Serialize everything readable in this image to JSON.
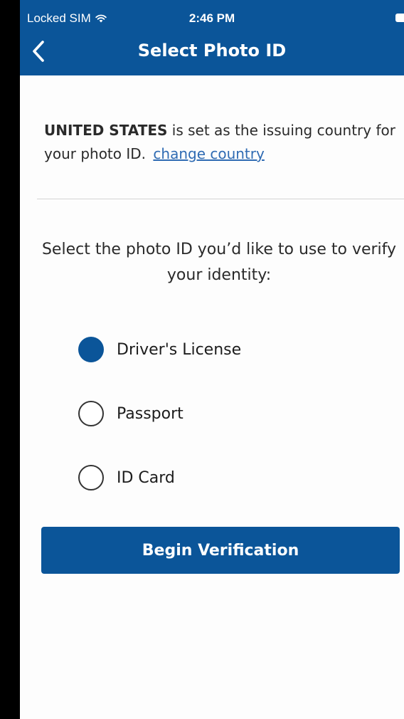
{
  "status_bar": {
    "carrier": "Locked SIM",
    "time": "2:46 PM"
  },
  "nav": {
    "title": "Select Photo ID",
    "back_icon": "chevron-left-icon"
  },
  "country": {
    "name": "UNITED STATES",
    "message": " is set as the issuing country for your photo ID.",
    "change_link": "change country"
  },
  "prompt": "Select the photo ID you’d like to use to verify your identity:",
  "options": [
    {
      "label": "Driver's License",
      "selected": true
    },
    {
      "label": "Passport",
      "selected": false
    },
    {
      "label": "ID Card",
      "selected": false
    }
  ],
  "action": {
    "begin_label": "Begin Verification"
  },
  "colors": {
    "brand": "#0b5599",
    "link": "#2f6bb3"
  }
}
